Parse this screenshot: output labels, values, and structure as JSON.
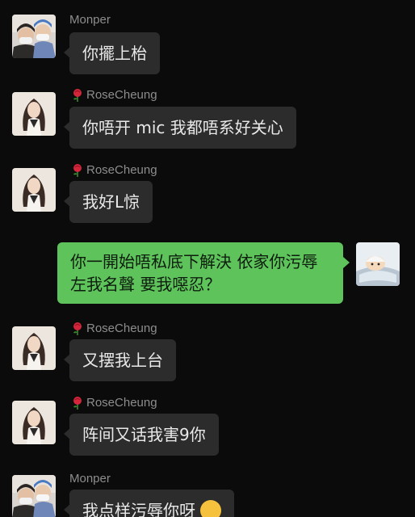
{
  "messages": [
    {
      "sender": "Monper",
      "text": "你擺上枱"
    },
    {
      "sender": "RoseCheung",
      "text": "你唔开 mic 我都唔系好关心"
    },
    {
      "sender": "RoseCheung",
      "text": "我好L惊"
    },
    {
      "sender": "",
      "text": "你一開始唔私底下解決 依家你污辱左我名聲 要我噁忍？"
    },
    {
      "sender": "RoseCheung",
      "text": "又摆我上台"
    },
    {
      "sender": "RoseCheung",
      "text": "阵间又话我害9你"
    },
    {
      "sender": "Monper",
      "text": "我点样污辱你呀"
    }
  ],
  "icons": {
    "rose": "rose-icon",
    "emoji": "smiling-face-icon"
  },
  "colors": {
    "background": "#0b0b0b",
    "incoming_bubble": "#2c2c2c",
    "outgoing_bubble": "#5fc35c",
    "sender_name": "#8d8d8d"
  }
}
